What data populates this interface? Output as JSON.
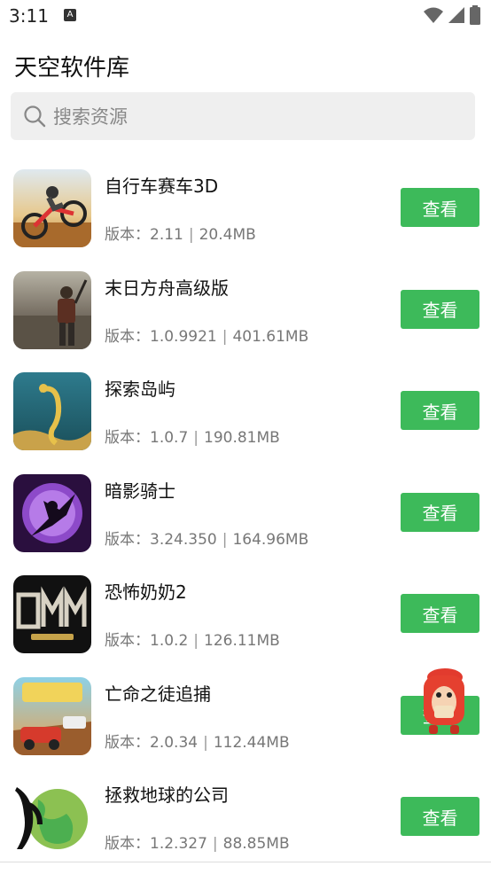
{
  "status_bar": {
    "time": "3:11",
    "notif_glyph": "A"
  },
  "header": {
    "title": "天空软件库"
  },
  "search": {
    "placeholder": "搜索资源"
  },
  "meta_prefix": "版本：",
  "separator": "|",
  "apps": [
    {
      "name": "自行车赛车3D",
      "version": "2.11",
      "size": "20.4MB",
      "button": "查看"
    },
    {
      "name": "末日方舟高级版",
      "version": "1.0.9921",
      "size": "401.61MB",
      "button": "查看"
    },
    {
      "name": "探索岛屿",
      "version": "1.0.7",
      "size": "190.81MB",
      "button": "查看"
    },
    {
      "name": "暗影骑士",
      "version": "3.24.350",
      "size": "164.96MB",
      "button": "查看"
    },
    {
      "name": "恐怖奶奶2",
      "version": "1.0.2",
      "size": "126.11MB",
      "button": "查看"
    },
    {
      "name": "亡命之徒追捕",
      "version": "2.0.34",
      "size": "112.44MB",
      "button": "查看"
    },
    {
      "name": "拯救地球的公司",
      "version": "1.2.327",
      "size": "88.85MB",
      "button": "查看"
    }
  ],
  "icons": {
    "search": "search-icon",
    "wifi": "wifi-icon",
    "signal": "signal-icon",
    "battery": "battery-icon"
  },
  "colors": {
    "accent": "#3dba5a",
    "search_bg": "#efefef"
  }
}
